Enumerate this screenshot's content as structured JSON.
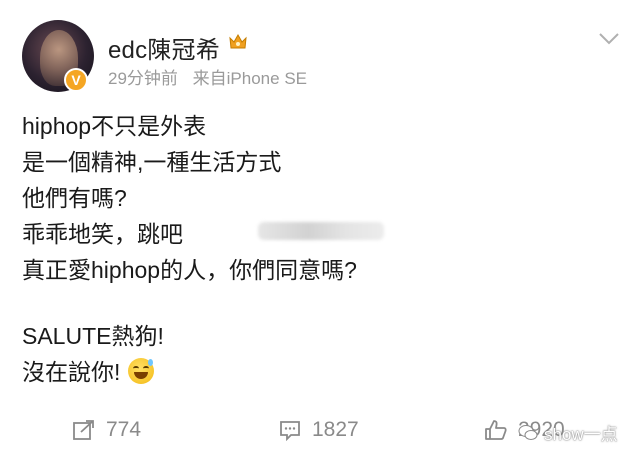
{
  "post": {
    "username": "edc陳冠希",
    "time": "29分钟前",
    "source": "来自iPhone SE",
    "content_lines": [
      "hiphop不只是外表",
      "是一個精神,一種生活方式",
      "他們有嗎?",
      "乖乖地笑，跳吧",
      "真正愛hiphop的人，你們同意嗎?",
      "",
      "SALUTE熱狗!",
      "沒在說你!"
    ],
    "emoji": "grinning-sweat-emoji"
  },
  "actions": {
    "repost_count": "774",
    "comment_count": "1827",
    "like_count": "2920"
  },
  "watermark": {
    "text": "show一点"
  },
  "colors": {
    "text": "#1a1a1a",
    "meta": "#9a9a9a",
    "action": "#8a8a8a",
    "badge": "#f5a623"
  },
  "icons": [
    "crown-icon",
    "chevron-down-icon",
    "repost-icon",
    "comment-icon",
    "like-icon",
    "wechat-watermark-icon"
  ]
}
